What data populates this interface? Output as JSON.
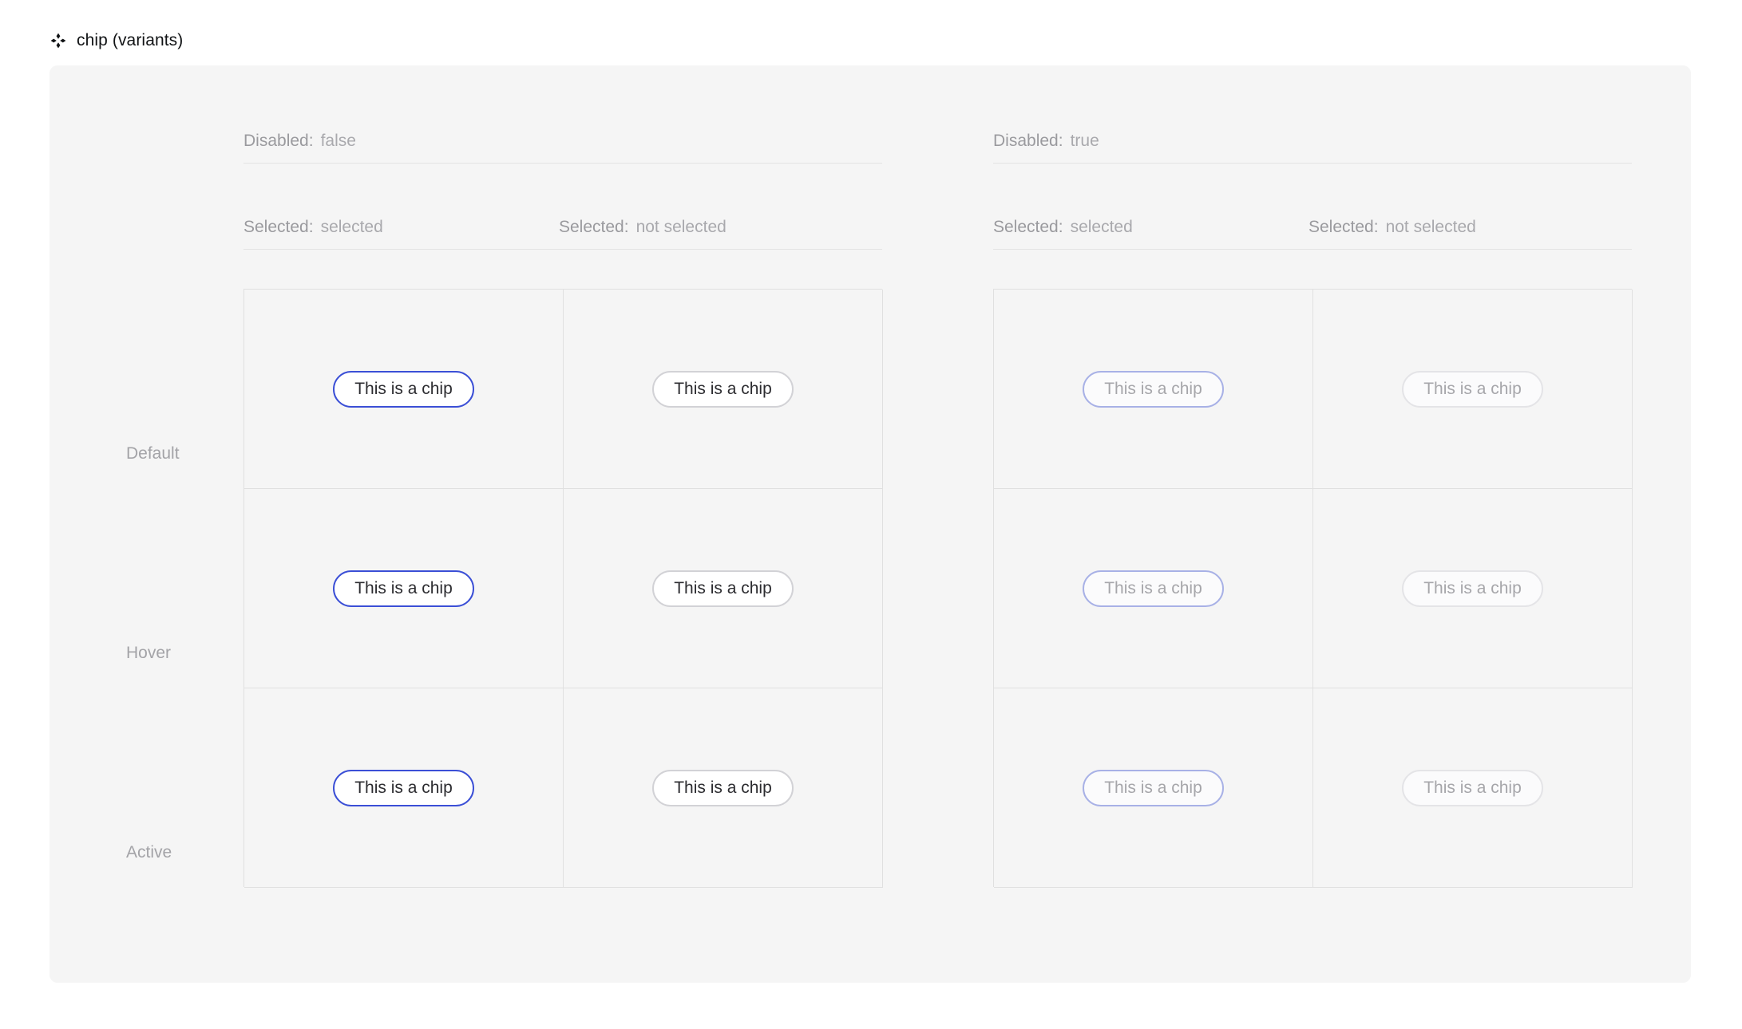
{
  "header": {
    "icon": "component-set-icon",
    "title": "chip (variants)"
  },
  "chip": {
    "label": "This is a chip"
  },
  "colors": {
    "selected_border": "#3b4fd6",
    "unselected_border": "#d2d2d6",
    "disabled_selected_border": "#a8b1e6",
    "disabled_unselected_border": "#e4e4e7",
    "text": "#2c2c30",
    "disabled_text": "#a6a6aa",
    "frame_background": "#f5f5f5",
    "grid_line": "#e0e0e0",
    "property_label": "#9a9a9e"
  },
  "states": [
    {
      "label": "Default"
    },
    {
      "label": "Hover"
    },
    {
      "label": "Active"
    }
  ],
  "groups": [
    {
      "id": "disabled-false",
      "property": {
        "key": "Disabled:",
        "value": "false"
      },
      "columns": [
        {
          "property": {
            "key": "Selected:",
            "value": "selected"
          },
          "variant": "selected"
        },
        {
          "property": {
            "key": "Selected:",
            "value": "not selected"
          },
          "variant": "unselected"
        }
      ],
      "disabled": false
    },
    {
      "id": "disabled-true",
      "property": {
        "key": "Disabled:",
        "value": "true"
      },
      "columns": [
        {
          "property": {
            "key": "Selected:",
            "value": "selected"
          },
          "variant": "selected"
        },
        {
          "property": {
            "key": "Selected:",
            "value": "not selected"
          },
          "variant": "unselected"
        }
      ],
      "disabled": true
    }
  ]
}
